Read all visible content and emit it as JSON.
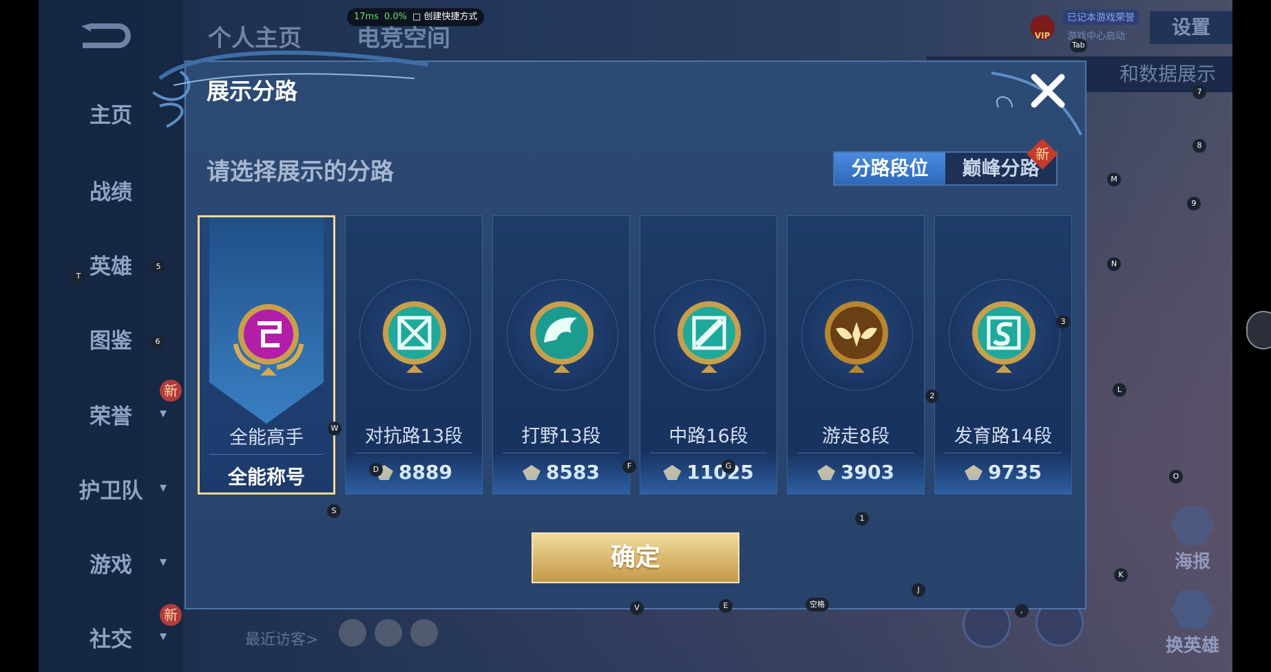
{
  "perf": {
    "ms": "17ms",
    "pct": "0.0%",
    "shortcut": "创建快捷方式"
  },
  "top_tabs": [
    "个人主页",
    "电竞空间"
  ],
  "sidebar": {
    "items": [
      {
        "label": "主页"
      },
      {
        "label": "战绩"
      },
      {
        "label": "英雄"
      },
      {
        "label": "图鉴"
      },
      {
        "label": "荣誉",
        "new": "新"
      },
      {
        "label": "护卫队"
      },
      {
        "label": "游戏"
      },
      {
        "label": "社交",
        "new": "新"
      }
    ]
  },
  "header": {
    "vip_label": "VIP",
    "vip_tag": "已记本游戏荣誉",
    "vip_sub": "游戏中心启动",
    "settings": "设置",
    "under_bar": "和数据展示"
  },
  "right_panel": {
    "poster": "海报",
    "swap_hero": "换英雄"
  },
  "visitors": {
    "label": "最近访客>"
  },
  "dialog": {
    "title": "展示分路",
    "prompt": "请选择展示的分路",
    "tabs": [
      {
        "label": "分路段位",
        "active": true
      },
      {
        "label": "巅峰分路",
        "active": false,
        "new": "新"
      }
    ],
    "cards": [
      {
        "label": "全能高手",
        "score": "全能称号",
        "selected": true,
        "emblem": "purple-versatile-emblem"
      },
      {
        "label": "对抗路13段",
        "score": "8889",
        "emblem": "clash-lane-emblem"
      },
      {
        "label": "打野13段",
        "score": "8583",
        "emblem": "jungle-dragon-emblem"
      },
      {
        "label": "中路16段",
        "score": "11025",
        "emblem": "mid-lane-emblem"
      },
      {
        "label": "游走8段",
        "score": "3903",
        "emblem": "roam-wings-emblem"
      },
      {
        "label": "发育路14段",
        "score": "9735",
        "emblem": "farm-lane-emblem"
      }
    ],
    "confirm": "确定"
  },
  "hotkeys": [
    "Tab",
    "7",
    "8",
    "M",
    "9",
    "N",
    "T",
    "5",
    "6",
    "3",
    "2",
    "L",
    "W",
    "D",
    "F",
    "G",
    "S",
    "1",
    "O",
    "K",
    "J",
    "V",
    "E",
    "空格",
    ","
  ],
  "colors": {
    "accent": "#3f7fd6",
    "gold": "#e4c996",
    "dialog_bg": "#2b4670",
    "selected_border": "#f3d79a",
    "badge_red": "#b23b3b"
  }
}
